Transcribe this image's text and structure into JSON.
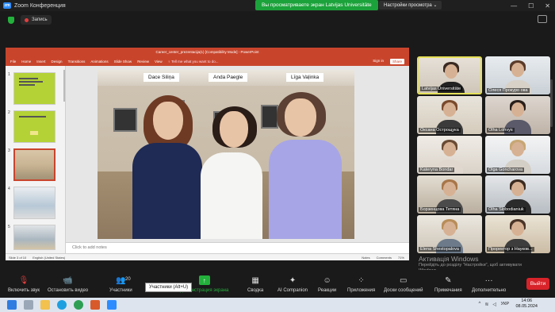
{
  "titlebar": {
    "app_title": "Zoom Конференция",
    "banner": "Вы просматриваете экран Latvijas Universitāte",
    "view_settings": "Настройки просмотра",
    "min": "—",
    "max": "☐",
    "close": "✕"
  },
  "recording": {
    "label": "Запись"
  },
  "ppt": {
    "window_title": "Career_center_prezentacija(1) [Compatibility Mode] - PowerPoint",
    "ribbon_tabs": [
      "File",
      "Home",
      "Insert",
      "Design",
      "Transitions",
      "Animations",
      "Slide Show",
      "Review",
      "View"
    ],
    "tell_me": "♀ Tell me what you want to do...",
    "sign_in": "Sign in",
    "share": "Share",
    "thumb_numbers": [
      "1",
      "2",
      "3",
      "4",
      "5"
    ],
    "name_tags": [
      "Dace Siliņa",
      "Anda Paegle",
      "Līga Vaļinka"
    ],
    "notes_placeholder": "Click to add notes",
    "status_slide": "Slide 3 of 10",
    "status_lang": "English (United States)",
    "status_notes": "Notes",
    "status_comments": "Comments",
    "zoom": "71%"
  },
  "participants": [
    {
      "name": "Latvijas Universitāte",
      "mic_muted": false
    },
    {
      "name": "Олеся Прокуро ова",
      "mic_muted": true
    },
    {
      "name": "Оксана Острощука",
      "mic_muted": true
    },
    {
      "name": "Olha Lohvys",
      "mic_muted": true
    },
    {
      "name": "Kateryna Bondar",
      "mic_muted": true
    },
    {
      "name": "Olga Goncharova",
      "mic_muted": true
    },
    {
      "name": "Борзенцова Тетяна",
      "mic_muted": true
    },
    {
      "name": "Olha Slobodianiuk",
      "mic_muted": true
    },
    {
      "name": "Elena Shestopalova",
      "mic_muted": false
    },
    {
      "name": "Проректор з Науков...",
      "mic_muted": true
    }
  ],
  "toolbar": {
    "unmute": "Включить звук",
    "stop_video": "Остановить видео",
    "participants": "Участники",
    "participants_count": "20",
    "share_screen": "Демонстрация экрана",
    "summary": "Сводка",
    "ai": "AI Companion",
    "reactions": "Реакции",
    "apps": "Приложения",
    "whiteboards": "Доски сообщений",
    "notes": "Примечания",
    "more": "Дополнительно",
    "end": "Выйти",
    "tooltip": "Участники (Alt+U)"
  },
  "watermark": {
    "title": "Активація Windows",
    "text": "Перейдіть до розділу \"Настройки\", щоб активувати Windows."
  },
  "taskbar": {
    "lang": "УКР",
    "time": "14:06",
    "date": "08.05.2024"
  }
}
